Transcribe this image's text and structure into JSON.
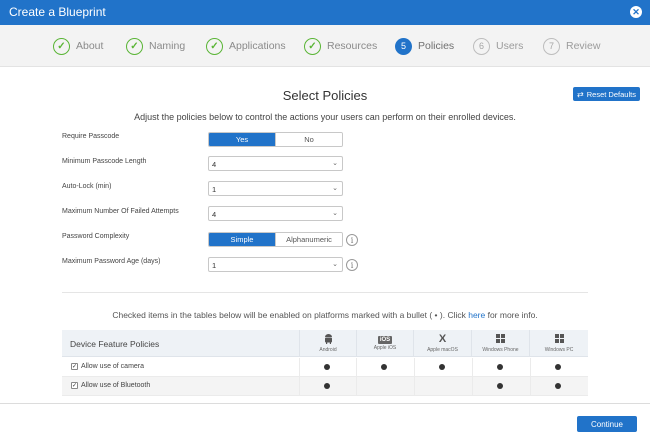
{
  "window": {
    "title": "Create a Blueprint"
  },
  "steps": [
    {
      "number": "✓",
      "label": "About",
      "state": "done"
    },
    {
      "number": "✓",
      "label": "Naming",
      "state": "done"
    },
    {
      "number": "✓",
      "label": "Applications",
      "state": "done"
    },
    {
      "number": "✓",
      "label": "Resources",
      "state": "done"
    },
    {
      "number": "5",
      "label": "Policies",
      "state": "current"
    },
    {
      "number": "6",
      "label": "Users",
      "state": "todo"
    },
    {
      "number": "7",
      "label": "Review",
      "state": "todo"
    }
  ],
  "page": {
    "title": "Select Policies",
    "subtitle": "Adjust the policies below to control the actions your users can perform on their enrolled devices.",
    "reset_label": "Reset Defaults"
  },
  "form": {
    "require_passcode": {
      "label": "Require Passcode",
      "options": [
        "Yes",
        "No"
      ],
      "selected": "Yes"
    },
    "min_length": {
      "label": "Minimum Passcode Length",
      "value": "4"
    },
    "auto_lock": {
      "label": "Auto-Lock (min)",
      "value": "1"
    },
    "max_failed": {
      "label": "Maximum Number Of Failed Attempts",
      "value": "4"
    },
    "complexity": {
      "label": "Password Complexity",
      "options": [
        "Simple",
        "Alphanumeric"
      ],
      "selected": "Simple"
    },
    "max_age": {
      "label": "Maximum Password Age (days)",
      "value": "1"
    }
  },
  "note": {
    "before": "Checked items in the tables below will be enabled on platforms marked with a bullet ( • ). Click ",
    "link": "here",
    "after": " for more info."
  },
  "table": {
    "caption": "Device Feature Policies",
    "platforms": [
      {
        "name": "Android",
        "icon": "android-icon"
      },
      {
        "name": "Apple iOS",
        "icon": "ios-icon",
        "glyph": "iOS"
      },
      {
        "name": "Apple macOS",
        "icon": "macos-icon",
        "glyph": "X"
      },
      {
        "name": "Windows Phone",
        "icon": "windows-icon"
      },
      {
        "name": "Windows PC",
        "icon": "windows-icon"
      }
    ],
    "rows": [
      {
        "label": "Allow use of camera",
        "checked": true,
        "support": [
          true,
          true,
          true,
          true,
          true
        ]
      },
      {
        "label": "Allow use of Bluetooth",
        "checked": true,
        "support": [
          true,
          false,
          false,
          true,
          true
        ]
      }
    ]
  },
  "footer": {
    "continue_label": "Continue"
  },
  "colors": {
    "accent": "#2173c9",
    "done": "#5ab536"
  }
}
